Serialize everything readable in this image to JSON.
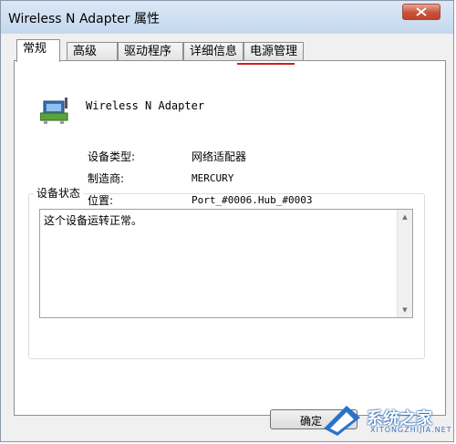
{
  "window": {
    "title": "Wireless N Adapter 属性"
  },
  "tabs": [
    {
      "label": "常规",
      "active": true
    },
    {
      "label": "高级",
      "active": false
    },
    {
      "label": "驱动程序",
      "active": false
    },
    {
      "label": "详细信息",
      "active": false
    },
    {
      "label": "电源管理",
      "active": false
    }
  ],
  "device": {
    "name": "Wireless N Adapter",
    "icon": "network-adapter-icon",
    "properties": [
      {
        "label": "设备类型:",
        "value": "网络适配器"
      },
      {
        "label": "制造商:",
        "value": "MERCURY"
      },
      {
        "label": "位置:",
        "value": "Port_#0006.Hub_#0003"
      }
    ]
  },
  "status": {
    "group_label": "设备状态",
    "text": "这个设备运转正常。"
  },
  "buttons": {
    "ok": "确定"
  },
  "watermark": {
    "text_cn": "系统之家",
    "text_en": "XITONGZHIJIA.NET"
  },
  "colors": {
    "highlight_underline": "#d41c1c",
    "close_button": "#c8523c"
  }
}
